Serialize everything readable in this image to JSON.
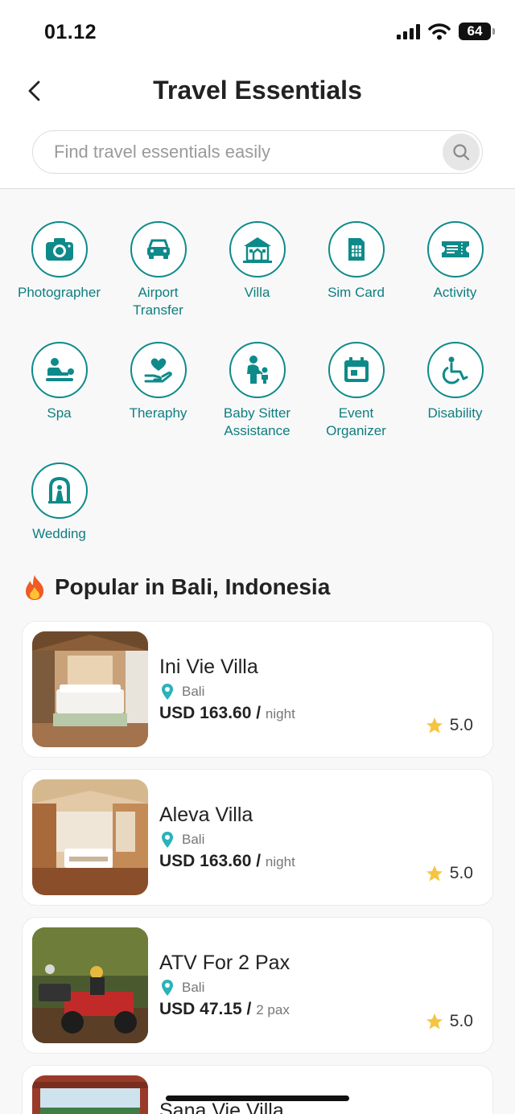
{
  "status_bar": {
    "time": "01.12",
    "battery": "64"
  },
  "header": {
    "title": "Travel Essentials"
  },
  "search": {
    "placeholder": "Find travel essentials easily"
  },
  "categories": [
    {
      "label": "Photographer",
      "icon": "camera-icon"
    },
    {
      "label": "Airport Transfer",
      "icon": "car-icon"
    },
    {
      "label": "Villa",
      "icon": "villa-icon"
    },
    {
      "label": "Sim Card",
      "icon": "sim-card-icon"
    },
    {
      "label": "Activity",
      "icon": "ticket-icon"
    },
    {
      "label": "Spa",
      "icon": "spa-icon"
    },
    {
      "label": "Theraphy",
      "icon": "heart-hand-icon"
    },
    {
      "label": "Baby Sitter Assistance",
      "icon": "baby-sitter-icon"
    },
    {
      "label": "Event Organizer",
      "icon": "calendar-icon"
    },
    {
      "label": "Disability",
      "icon": "wheelchair-icon"
    },
    {
      "label": "Wedding",
      "icon": "wedding-arch-icon"
    }
  ],
  "popular": {
    "title": "Popular in Bali, Indonesia",
    "items": [
      {
        "name": "Ini Vie Villa",
        "location": "Bali",
        "price": "USD 163.60 /",
        "unit": "night",
        "rating": "5.0"
      },
      {
        "name": "Aleva Villa",
        "location": "Bali",
        "price": "USD 163.60 /",
        "unit": "night",
        "rating": "5.0"
      },
      {
        "name": "ATV For 2 Pax",
        "location": "Bali",
        "price": "USD 47.15 /",
        "unit": "2 pax",
        "rating": "5.0"
      },
      {
        "name": "Sana Vie Villa"
      }
    ]
  },
  "colors": {
    "accent": "#0e8a8a",
    "text": "#222222",
    "star": "#f5c542",
    "pin": "#2ab3b8"
  }
}
